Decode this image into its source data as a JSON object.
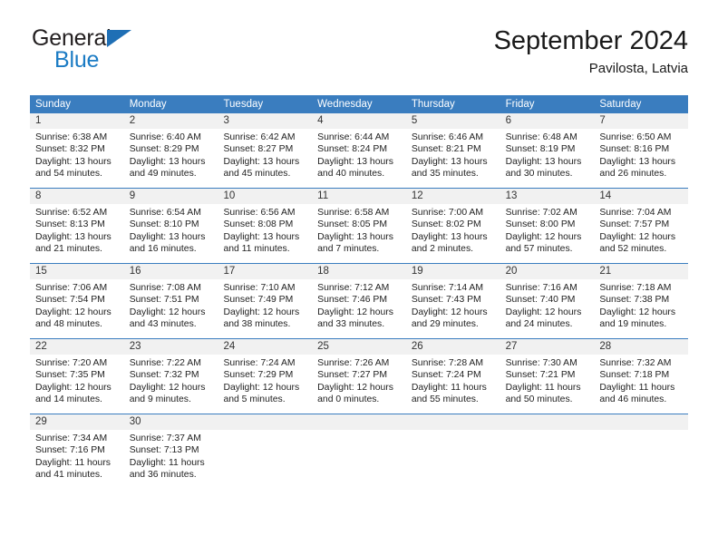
{
  "brand": {
    "word_one": "General",
    "word_two": "Blue",
    "icon": "triangle-logo"
  },
  "header": {
    "title": "September 2024",
    "location": "Pavilosta, Latvia"
  },
  "calendar": {
    "weekdays": [
      "Sunday",
      "Monday",
      "Tuesday",
      "Wednesday",
      "Thursday",
      "Friday",
      "Saturday"
    ],
    "colors": {
      "header_blue": "#3a7dbf",
      "daynum_band": "#f1f1f1",
      "brand_blue": "#1b7bc4",
      "text": "#222222"
    },
    "weeks": [
      [
        {
          "day": "1",
          "sunrise": "Sunrise: 6:38 AM",
          "sunset": "Sunset: 8:32 PM",
          "daylight_1": "Daylight: 13 hours",
          "daylight_2": "and 54 minutes."
        },
        {
          "day": "2",
          "sunrise": "Sunrise: 6:40 AM",
          "sunset": "Sunset: 8:29 PM",
          "daylight_1": "Daylight: 13 hours",
          "daylight_2": "and 49 minutes."
        },
        {
          "day": "3",
          "sunrise": "Sunrise: 6:42 AM",
          "sunset": "Sunset: 8:27 PM",
          "daylight_1": "Daylight: 13 hours",
          "daylight_2": "and 45 minutes."
        },
        {
          "day": "4",
          "sunrise": "Sunrise: 6:44 AM",
          "sunset": "Sunset: 8:24 PM",
          "daylight_1": "Daylight: 13 hours",
          "daylight_2": "and 40 minutes."
        },
        {
          "day": "5",
          "sunrise": "Sunrise: 6:46 AM",
          "sunset": "Sunset: 8:21 PM",
          "daylight_1": "Daylight: 13 hours",
          "daylight_2": "and 35 minutes."
        },
        {
          "day": "6",
          "sunrise": "Sunrise: 6:48 AM",
          "sunset": "Sunset: 8:19 PM",
          "daylight_1": "Daylight: 13 hours",
          "daylight_2": "and 30 minutes."
        },
        {
          "day": "7",
          "sunrise": "Sunrise: 6:50 AM",
          "sunset": "Sunset: 8:16 PM",
          "daylight_1": "Daylight: 13 hours",
          "daylight_2": "and 26 minutes."
        }
      ],
      [
        {
          "day": "8",
          "sunrise": "Sunrise: 6:52 AM",
          "sunset": "Sunset: 8:13 PM",
          "daylight_1": "Daylight: 13 hours",
          "daylight_2": "and 21 minutes."
        },
        {
          "day": "9",
          "sunrise": "Sunrise: 6:54 AM",
          "sunset": "Sunset: 8:10 PM",
          "daylight_1": "Daylight: 13 hours",
          "daylight_2": "and 16 minutes."
        },
        {
          "day": "10",
          "sunrise": "Sunrise: 6:56 AM",
          "sunset": "Sunset: 8:08 PM",
          "daylight_1": "Daylight: 13 hours",
          "daylight_2": "and 11 minutes."
        },
        {
          "day": "11",
          "sunrise": "Sunrise: 6:58 AM",
          "sunset": "Sunset: 8:05 PM",
          "daylight_1": "Daylight: 13 hours",
          "daylight_2": "and 7 minutes."
        },
        {
          "day": "12",
          "sunrise": "Sunrise: 7:00 AM",
          "sunset": "Sunset: 8:02 PM",
          "daylight_1": "Daylight: 13 hours",
          "daylight_2": "and 2 minutes."
        },
        {
          "day": "13",
          "sunrise": "Sunrise: 7:02 AM",
          "sunset": "Sunset: 8:00 PM",
          "daylight_1": "Daylight: 12 hours",
          "daylight_2": "and 57 minutes."
        },
        {
          "day": "14",
          "sunrise": "Sunrise: 7:04 AM",
          "sunset": "Sunset: 7:57 PM",
          "daylight_1": "Daylight: 12 hours",
          "daylight_2": "and 52 minutes."
        }
      ],
      [
        {
          "day": "15",
          "sunrise": "Sunrise: 7:06 AM",
          "sunset": "Sunset: 7:54 PM",
          "daylight_1": "Daylight: 12 hours",
          "daylight_2": "and 48 minutes."
        },
        {
          "day": "16",
          "sunrise": "Sunrise: 7:08 AM",
          "sunset": "Sunset: 7:51 PM",
          "daylight_1": "Daylight: 12 hours",
          "daylight_2": "and 43 minutes."
        },
        {
          "day": "17",
          "sunrise": "Sunrise: 7:10 AM",
          "sunset": "Sunset: 7:49 PM",
          "daylight_1": "Daylight: 12 hours",
          "daylight_2": "and 38 minutes."
        },
        {
          "day": "18",
          "sunrise": "Sunrise: 7:12 AM",
          "sunset": "Sunset: 7:46 PM",
          "daylight_1": "Daylight: 12 hours",
          "daylight_2": "and 33 minutes."
        },
        {
          "day": "19",
          "sunrise": "Sunrise: 7:14 AM",
          "sunset": "Sunset: 7:43 PM",
          "daylight_1": "Daylight: 12 hours",
          "daylight_2": "and 29 minutes."
        },
        {
          "day": "20",
          "sunrise": "Sunrise: 7:16 AM",
          "sunset": "Sunset: 7:40 PM",
          "daylight_1": "Daylight: 12 hours",
          "daylight_2": "and 24 minutes."
        },
        {
          "day": "21",
          "sunrise": "Sunrise: 7:18 AM",
          "sunset": "Sunset: 7:38 PM",
          "daylight_1": "Daylight: 12 hours",
          "daylight_2": "and 19 minutes."
        }
      ],
      [
        {
          "day": "22",
          "sunrise": "Sunrise: 7:20 AM",
          "sunset": "Sunset: 7:35 PM",
          "daylight_1": "Daylight: 12 hours",
          "daylight_2": "and 14 minutes."
        },
        {
          "day": "23",
          "sunrise": "Sunrise: 7:22 AM",
          "sunset": "Sunset: 7:32 PM",
          "daylight_1": "Daylight: 12 hours",
          "daylight_2": "and 9 minutes."
        },
        {
          "day": "24",
          "sunrise": "Sunrise: 7:24 AM",
          "sunset": "Sunset: 7:29 PM",
          "daylight_1": "Daylight: 12 hours",
          "daylight_2": "and 5 minutes."
        },
        {
          "day": "25",
          "sunrise": "Sunrise: 7:26 AM",
          "sunset": "Sunset: 7:27 PM",
          "daylight_1": "Daylight: 12 hours",
          "daylight_2": "and 0 minutes."
        },
        {
          "day": "26",
          "sunrise": "Sunrise: 7:28 AM",
          "sunset": "Sunset: 7:24 PM",
          "daylight_1": "Daylight: 11 hours",
          "daylight_2": "and 55 minutes."
        },
        {
          "day": "27",
          "sunrise": "Sunrise: 7:30 AM",
          "sunset": "Sunset: 7:21 PM",
          "daylight_1": "Daylight: 11 hours",
          "daylight_2": "and 50 minutes."
        },
        {
          "day": "28",
          "sunrise": "Sunrise: 7:32 AM",
          "sunset": "Sunset: 7:18 PM",
          "daylight_1": "Daylight: 11 hours",
          "daylight_2": "and 46 minutes."
        }
      ],
      [
        {
          "day": "29",
          "sunrise": "Sunrise: 7:34 AM",
          "sunset": "Sunset: 7:16 PM",
          "daylight_1": "Daylight: 11 hours",
          "daylight_2": "and 41 minutes."
        },
        {
          "day": "30",
          "sunrise": "Sunrise: 7:37 AM",
          "sunset": "Sunset: 7:13 PM",
          "daylight_1": "Daylight: 11 hours",
          "daylight_2": "and 36 minutes."
        },
        {
          "day": "",
          "sunrise": "",
          "sunset": "",
          "daylight_1": "",
          "daylight_2": ""
        },
        {
          "day": "",
          "sunrise": "",
          "sunset": "",
          "daylight_1": "",
          "daylight_2": ""
        },
        {
          "day": "",
          "sunrise": "",
          "sunset": "",
          "daylight_1": "",
          "daylight_2": ""
        },
        {
          "day": "",
          "sunrise": "",
          "sunset": "",
          "daylight_1": "",
          "daylight_2": ""
        },
        {
          "day": "",
          "sunrise": "",
          "sunset": "",
          "daylight_1": "",
          "daylight_2": ""
        }
      ]
    ]
  }
}
